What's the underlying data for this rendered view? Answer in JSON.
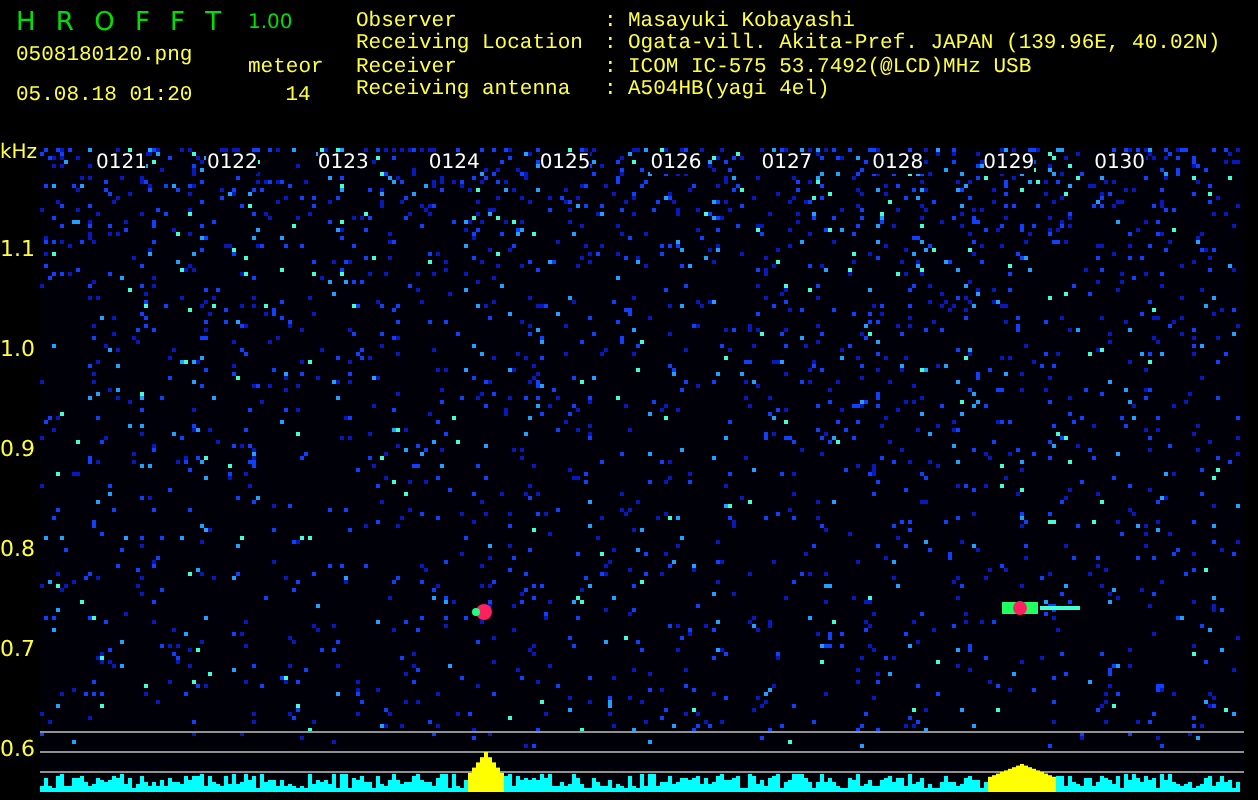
{
  "app": {
    "name": "H R O F F T",
    "version": "1.00"
  },
  "file": {
    "name": "0508180120.png",
    "timestamp": "05.08.18 01:20"
  },
  "meteor": {
    "label": "meteor",
    "count": "14"
  },
  "info": [
    {
      "label": "Observer",
      "separator": ":",
      "value": "Masayuki Kobayashi"
    },
    {
      "label": "Receiving Location",
      "separator": ":",
      "value": "Ogata-vill. Akita-Pref. JAPAN (139.96E, 40.02N)"
    },
    {
      "label": "Receiver",
      "separator": ":",
      "value": "ICOM IC-575 53.7492(@LCD)MHz USB"
    },
    {
      "label": "Receiving antenna",
      "separator": ":",
      "value": "A504HB(yagi 4el)"
    }
  ],
  "plot": {
    "y_unit": "kHz",
    "y_labels": [
      "1.1",
      "1.0",
      "0.9",
      "0.8",
      "0.7",
      "0.6"
    ],
    "time_labels": [
      "0121",
      "0122",
      "0123",
      "0124",
      "0125",
      "0126",
      "0127",
      "0128",
      "0129",
      "0130"
    ]
  }
}
